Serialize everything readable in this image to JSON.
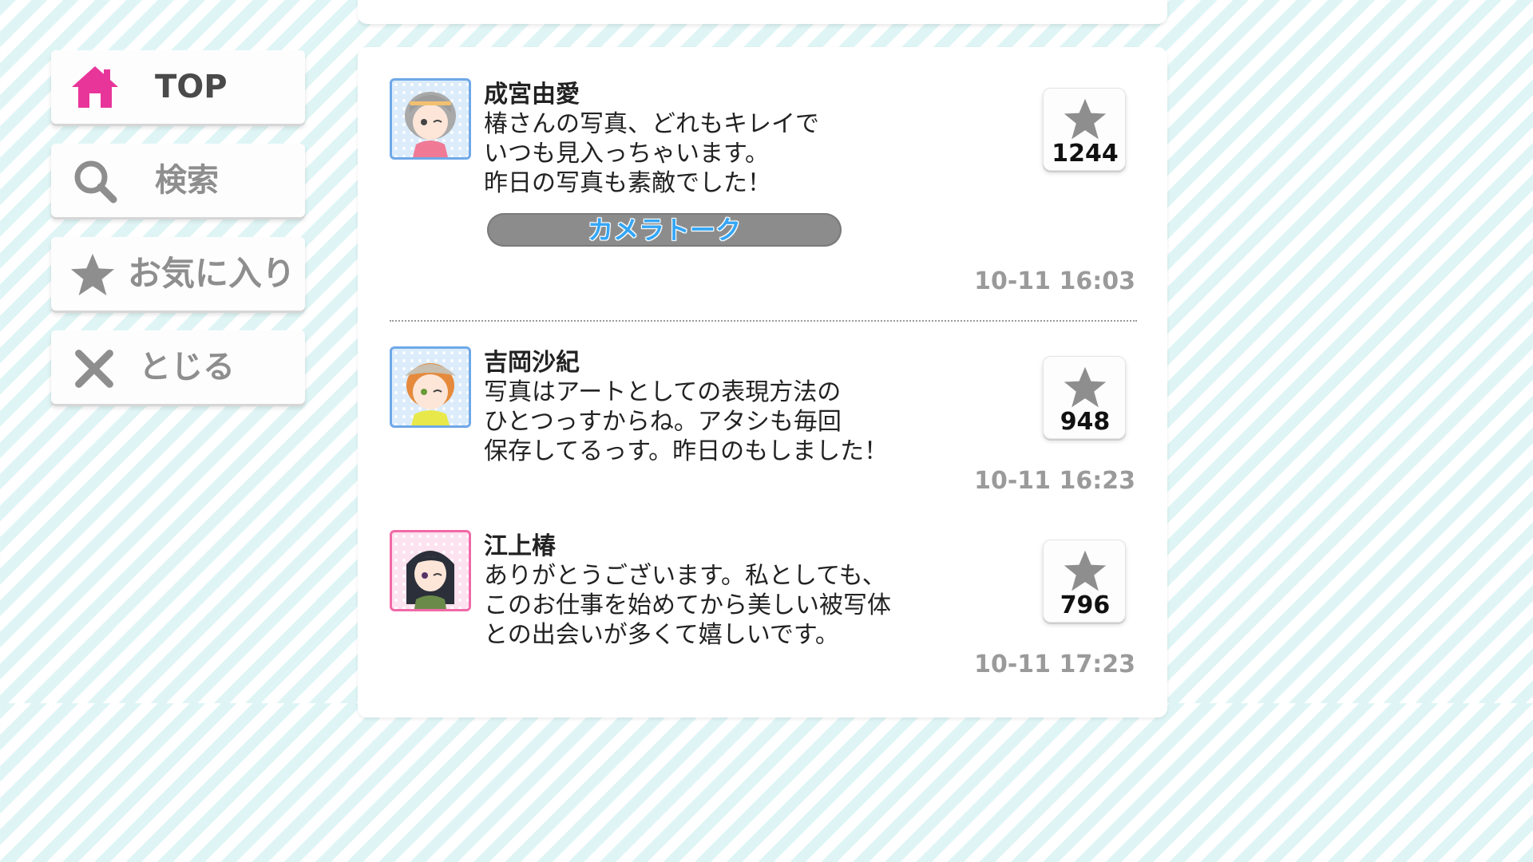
{
  "menu": {
    "top_label": "TOP",
    "search_label": "検索",
    "favorites_label": "お気に入り",
    "close_label": "とじる"
  },
  "colors": {
    "accent_pink": "#e8359a",
    "menu_gray": "#8e8e8e",
    "stripe_cyan": "#dff5f5",
    "tag_text_blue": "#35a6f5"
  },
  "comments": [
    {
      "author": "成宮由愛",
      "lines": [
        "椿さんの写真、どれもキレイで",
        "いつも見入っちゃいます。",
        "昨日の写真も素敵でした！"
      ],
      "tag": "カメラトーク",
      "likes": "1244",
      "timestamp": "10-11 16:03",
      "avatar_icon": "avatar-icon"
    },
    {
      "author": "吉岡沙紀",
      "lines": [
        "写真はアートとしての表現方法の",
        "ひとつっすからね。アタシも毎回",
        "保存してるっす。昨日のもしました！"
      ],
      "likes": "948",
      "timestamp": "10-11 16:23",
      "avatar_icon": "avatar-icon"
    },
    {
      "author": "江上椿",
      "lines": [
        "ありがとうございます。私としても、",
        "このお仕事を始めてから美しい被写体",
        "との出会いが多くて嬉しいです。"
      ],
      "likes": "796",
      "timestamp": "10-11 17:23",
      "avatar_icon": "avatar-icon"
    }
  ]
}
